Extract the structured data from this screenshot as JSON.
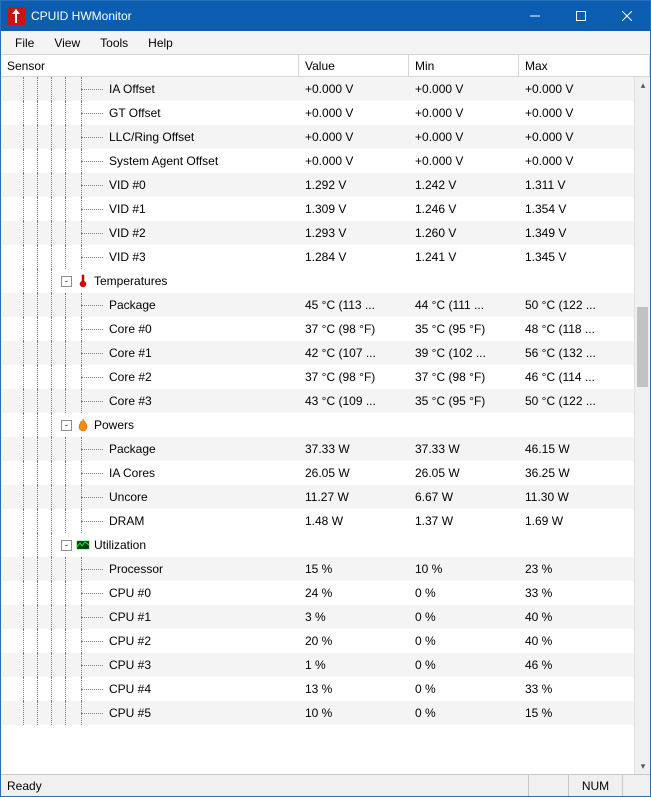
{
  "title": "CPUID HWMonitor",
  "menu": {
    "file": "File",
    "view": "View",
    "tools": "Tools",
    "help": "Help"
  },
  "columns": {
    "sensor": "Sensor",
    "value": "Value",
    "min": "Min",
    "max": "Max"
  },
  "status": {
    "ready": "Ready",
    "num": "NUM"
  },
  "leafIndent": 108,
  "groupIndent": 60,
  "treeVLines": [
    22,
    36,
    50,
    64,
    80
  ],
  "rows": [
    {
      "type": "leaf",
      "zebra": true,
      "name": "IA Offset",
      "value": "+0.000 V",
      "min": "+0.000 V",
      "max": "+0.000 V"
    },
    {
      "type": "leaf",
      "zebra": false,
      "name": "GT Offset",
      "value": "+0.000 V",
      "min": "+0.000 V",
      "max": "+0.000 V"
    },
    {
      "type": "leaf",
      "zebra": true,
      "name": "LLC/Ring Offset",
      "value": "+0.000 V",
      "min": "+0.000 V",
      "max": "+0.000 V"
    },
    {
      "type": "leaf",
      "zebra": false,
      "name": "System Agent Offset",
      "value": "+0.000 V",
      "min": "+0.000 V",
      "max": "+0.000 V"
    },
    {
      "type": "leaf",
      "zebra": true,
      "name": "VID #0",
      "value": "1.292 V",
      "min": "1.242 V",
      "max": "1.311 V"
    },
    {
      "type": "leaf",
      "zebra": false,
      "name": "VID #1",
      "value": "1.309 V",
      "min": "1.246 V",
      "max": "1.354 V"
    },
    {
      "type": "leaf",
      "zebra": true,
      "name": "VID #2",
      "value": "1.293 V",
      "min": "1.260 V",
      "max": "1.349 V"
    },
    {
      "type": "leaf",
      "zebra": false,
      "name": "VID #3",
      "value": "1.284 V",
      "min": "1.241 V",
      "max": "1.345 V"
    },
    {
      "type": "group",
      "zebra": false,
      "label": "Temperatures",
      "icon": "thermometer-icon"
    },
    {
      "type": "leaf",
      "zebra": true,
      "name": "Package",
      "value": "45 °C  (113 ...",
      "min": "44 °C  (111 ...",
      "max": "50 °C  (122 ..."
    },
    {
      "type": "leaf",
      "zebra": false,
      "name": "Core #0",
      "value": "37 °C  (98 °F)",
      "min": "35 °C  (95 °F)",
      "max": "48 °C  (118 ..."
    },
    {
      "type": "leaf",
      "zebra": true,
      "name": "Core #1",
      "value": "42 °C  (107 ...",
      "min": "39 °C  (102 ...",
      "max": "56 °C  (132 ..."
    },
    {
      "type": "leaf",
      "zebra": false,
      "name": "Core #2",
      "value": "37 °C  (98 °F)",
      "min": "37 °C  (98 °F)",
      "max": "46 °C  (114 ..."
    },
    {
      "type": "leaf",
      "zebra": true,
      "name": "Core #3",
      "value": "43 °C  (109 ...",
      "min": "35 °C  (95 °F)",
      "max": "50 °C  (122 ..."
    },
    {
      "type": "group",
      "zebra": false,
      "label": "Powers",
      "icon": "fire-icon"
    },
    {
      "type": "leaf",
      "zebra": true,
      "name": "Package",
      "value": "37.33 W",
      "min": "37.33 W",
      "max": "46.15 W"
    },
    {
      "type": "leaf",
      "zebra": false,
      "name": "IA Cores",
      "value": "26.05 W",
      "min": "26.05 W",
      "max": "36.25 W"
    },
    {
      "type": "leaf",
      "zebra": true,
      "name": "Uncore",
      "value": "11.27 W",
      "min": "6.67 W",
      "max": "11.30 W"
    },
    {
      "type": "leaf",
      "zebra": false,
      "name": "DRAM",
      "value": "1.48 W",
      "min": "1.37 W",
      "max": "1.69 W"
    },
    {
      "type": "group",
      "zebra": false,
      "label": "Utilization",
      "icon": "utilization-icon"
    },
    {
      "type": "leaf",
      "zebra": true,
      "name": "Processor",
      "value": "15 %",
      "min": "10 %",
      "max": "23 %"
    },
    {
      "type": "leaf",
      "zebra": false,
      "name": "CPU #0",
      "value": "24 %",
      "min": "0 %",
      "max": "33 %"
    },
    {
      "type": "leaf",
      "zebra": true,
      "name": "CPU #1",
      "value": "3 %",
      "min": "0 %",
      "max": "40 %"
    },
    {
      "type": "leaf",
      "zebra": false,
      "name": "CPU #2",
      "value": "20 %",
      "min": "0 %",
      "max": "40 %"
    },
    {
      "type": "leaf",
      "zebra": true,
      "name": "CPU #3",
      "value": "1 %",
      "min": "0 %",
      "max": "46 %"
    },
    {
      "type": "leaf",
      "zebra": false,
      "name": "CPU #4",
      "value": "13 %",
      "min": "0 %",
      "max": "33 %"
    },
    {
      "type": "leaf",
      "zebra": true,
      "name": "CPU #5",
      "value": "10 %",
      "min": "0 %",
      "max": "15 %"
    }
  ]
}
